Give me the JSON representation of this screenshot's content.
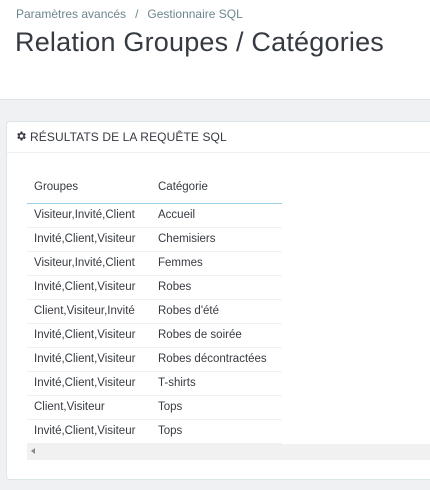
{
  "breadcrumb": {
    "parent": "Paramètres avancés",
    "separator": "/",
    "current": "Gestionnaire SQL"
  },
  "page_title": "Relation Groupes / Catégories",
  "panel": {
    "icon": "gear-icon",
    "title": "RÉSULTATS DE LA REQUÊTE SQL"
  },
  "table": {
    "headers": [
      "Groupes",
      "Catégorie"
    ],
    "rows": [
      [
        "Visiteur,Invité,Client",
        "Accueil"
      ],
      [
        "Invité,Client,Visiteur",
        "Chemisiers"
      ],
      [
        "Visiteur,Invité,Client",
        "Femmes"
      ],
      [
        "Invité,Client,Visiteur",
        "Robes"
      ],
      [
        "Client,Visiteur,Invité",
        "Robes d'été"
      ],
      [
        "Invité,Client,Visiteur",
        "Robes de soirée"
      ],
      [
        "Invité,Client,Visiteur",
        "Robes décontractées"
      ],
      [
        "Invité,Client,Visiteur",
        "T-shirts"
      ],
      [
        "Client,Visiteur",
        "Tops"
      ],
      [
        "Invité,Client,Visiteur",
        "Tops"
      ]
    ]
  },
  "colors": {
    "header_underline": "#a0d0e4",
    "page_background": "#eff1f2",
    "text": "#363a41"
  }
}
